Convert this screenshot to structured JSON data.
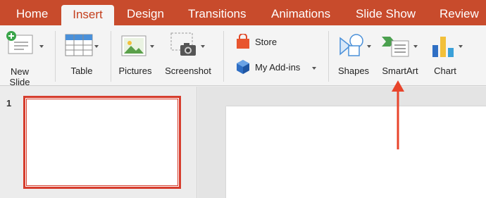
{
  "tabs": [
    {
      "label": "Home",
      "active": false
    },
    {
      "label": "Insert",
      "active": true
    },
    {
      "label": "Design",
      "active": false
    },
    {
      "label": "Transitions",
      "active": false
    },
    {
      "label": "Animations",
      "active": false
    },
    {
      "label": "Slide Show",
      "active": false
    },
    {
      "label": "Review",
      "active": false
    }
  ],
  "ribbon": {
    "new_slide": {
      "label_line1": "New",
      "label_line2": "Slide"
    },
    "table": {
      "label": "Table"
    },
    "pictures": {
      "label": "Pictures"
    },
    "screenshot": {
      "label": "Screenshot"
    },
    "store": {
      "label": "Store"
    },
    "my_addins": {
      "label": "My Add-ins"
    },
    "shapes": {
      "label": "Shapes"
    },
    "smartart": {
      "label": "SmartArt"
    },
    "chart": {
      "label": "Chart"
    }
  },
  "slides": {
    "thumbnails": [
      {
        "number": "1",
        "selected": true
      }
    ]
  },
  "colors": {
    "tabbar_bg": "#c84b2c",
    "active_tab_text": "#c43e1c",
    "selection_border": "#d63d2d",
    "annotation_arrow": "#e8442b"
  },
  "icons": [
    "new-slide-icon",
    "table-icon",
    "pictures-icon",
    "screenshot-icon",
    "store-icon",
    "my-addins-icon",
    "shapes-icon",
    "smartart-icon",
    "chart-icon"
  ]
}
